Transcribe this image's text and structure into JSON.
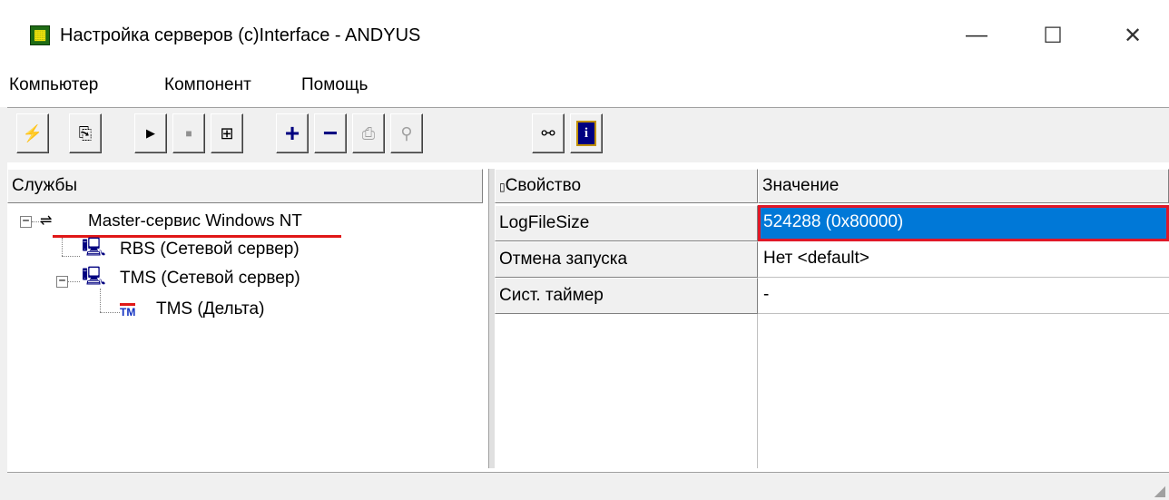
{
  "window": {
    "title": "Настройка серверов (c)Interface - ANDYUS",
    "minimize_glyph": "—",
    "maximize_glyph": "☐",
    "close_glyph": "✕"
  },
  "menu": [
    {
      "label": "Компьютер"
    },
    {
      "label": "Компонент"
    },
    {
      "label": "Помощь"
    }
  ],
  "toolbar": {
    "buttons": [
      {
        "icon": "lightning-icon",
        "glyph": "⚡",
        "enabled": true
      },
      {
        "icon": "copy-computer-icon",
        "glyph": "⎘",
        "enabled": true
      },
      {
        "icon": "play-icon",
        "glyph": "▶",
        "enabled": true
      },
      {
        "icon": "stop-icon",
        "glyph": "■",
        "enabled": true
      },
      {
        "icon": "network-icon",
        "glyph": "⊞",
        "enabled": true
      },
      {
        "icon": "add-icon",
        "glyph": "+",
        "enabled": true
      },
      {
        "icon": "remove-icon",
        "glyph": "−",
        "enabled": true
      },
      {
        "icon": "properties-icon",
        "glyph": "⎙",
        "enabled": false
      },
      {
        "icon": "search-help-icon",
        "glyph": "⚲",
        "enabled": false
      },
      {
        "icon": "connect-icon",
        "glyph": "⚯",
        "enabled": true
      },
      {
        "icon": "info-icon",
        "glyph": "i",
        "enabled": true
      }
    ]
  },
  "services": {
    "header": "Службы",
    "nodes": [
      {
        "label": "Master-сервис Windows NT",
        "toggle": "−"
      },
      {
        "label": "RBS (Сетевой сервер)"
      },
      {
        "label": "TMS (Сетевой сервер)",
        "toggle": "−"
      },
      {
        "label": "TMS (Дельта)",
        "icon_text": "TM"
      }
    ]
  },
  "properties": {
    "header_property": "Свойство",
    "header_value": "Значение",
    "rows": [
      {
        "name": "LogFileSize",
        "value": "524288 (0x80000)",
        "selected": true
      },
      {
        "name": "Отмена запуска",
        "value": "Нет <default>"
      },
      {
        "name": "Сист. таймер",
        "value": "-"
      }
    ]
  },
  "colors": {
    "selection": "#0078d7",
    "highlight_border": "#e01828",
    "app_icon_bg": "#1f6b14"
  }
}
